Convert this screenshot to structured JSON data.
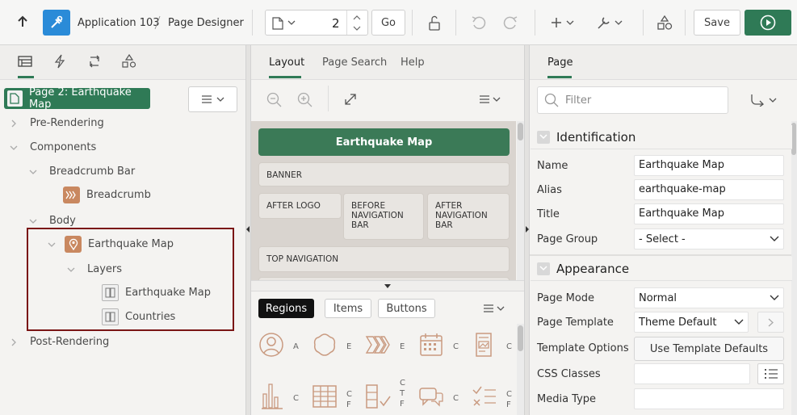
{
  "toolbar": {
    "app_name": "Application 103",
    "page_designer": "Page Designer",
    "page_number": "2",
    "go_label": "Go",
    "save_label": "Save"
  },
  "left": {
    "page_badge": "Page 2: Earthquake Map",
    "tree": {
      "pre_rendering": "Pre-Rendering",
      "components": "Components",
      "breadcrumb_bar": "Breadcrumb Bar",
      "breadcrumb": "Breadcrumb",
      "body": "Body",
      "earthquake_map": "Earthquake Map",
      "layers": "Layers",
      "layer_earthquake": "Earthquake Map",
      "layer_countries": "Countries",
      "post_rendering": "Post-Rendering"
    }
  },
  "center": {
    "tabs": [
      "Layout",
      "Page Search",
      "Help"
    ],
    "page_title_bar": "Earthquake Map",
    "slots": {
      "banner": "BANNER",
      "after_logo": "AFTER LOGO",
      "before_nav": "BEFORE NAVIGATION BAR",
      "after_nav": "AFTER NAVIGATION BAR",
      "top_nav": "TOP NAVIGATION"
    },
    "gallery_tabs": [
      "Regions",
      "Items",
      "Buttons"
    ],
    "gallery_labels": [
      "A",
      "E",
      "E",
      "C",
      "C",
      "C",
      "C F",
      "C T F",
      "C",
      "C F"
    ]
  },
  "right": {
    "tab": "Page",
    "filter_placeholder": "Filter",
    "identification": {
      "header": "Identification",
      "name_label": "Name",
      "name_value": "Earthquake Map",
      "alias_label": "Alias",
      "alias_value": "earthquake-map",
      "title_label": "Title",
      "title_value": "Earthquake Map",
      "group_label": "Page Group",
      "group_value": "- Select -"
    },
    "appearance": {
      "header": "Appearance",
      "mode_label": "Page Mode",
      "mode_value": "Normal",
      "template_label": "Page Template",
      "template_value": "Theme Default",
      "options_label": "Template Options",
      "options_button": "Use Template Defaults",
      "css_label": "CSS Classes",
      "media_label": "Media Type"
    }
  },
  "colors": {
    "accent_green": "#2f7a56",
    "highlight_border": "#7a1515",
    "builder_blue": "#2a8bd8"
  }
}
